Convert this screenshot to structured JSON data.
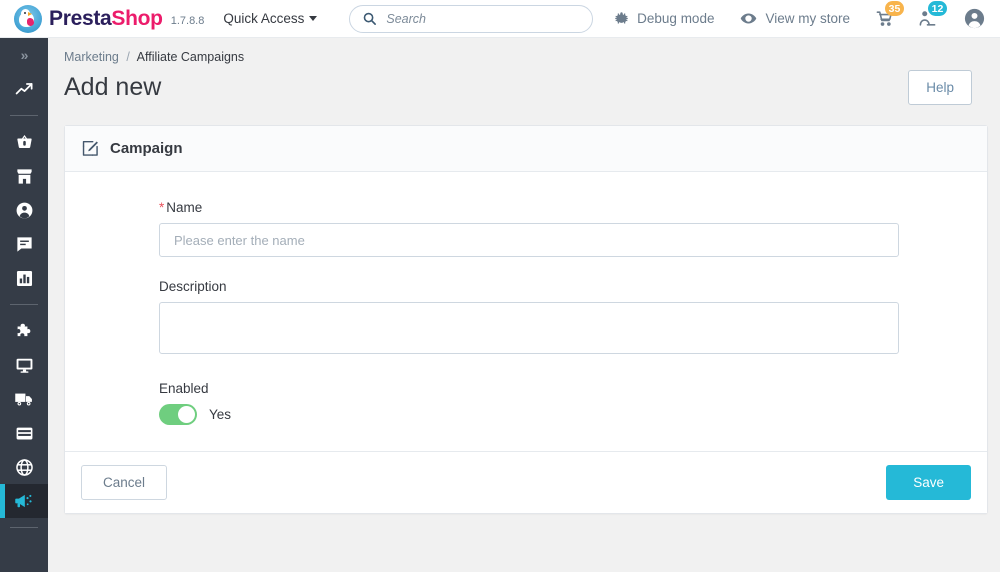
{
  "header": {
    "brand_primary": "Presta",
    "brand_secondary": "Shop",
    "version": "1.7.8.8",
    "quick_access_label": "Quick Access",
    "search_placeholder": "Search",
    "search_value": "",
    "debug_mode_label": "Debug mode",
    "view_store_label": "View my store",
    "orders_badge": "35",
    "customers_badge": "12",
    "badge_orange_color": "#f8b44c",
    "badge_blue_color": "#25b9d7"
  },
  "sidebar": {
    "expand_label": "»",
    "accent_color": "#25b9d7",
    "items": [
      {
        "name": "dashboard",
        "icon": "trending-up-icon"
      },
      {
        "name": "orders",
        "icon": "basket-icon"
      },
      {
        "name": "catalog",
        "icon": "store-icon"
      },
      {
        "name": "customers",
        "icon": "person-icon"
      },
      {
        "name": "customer-service",
        "icon": "chat-bubble-icon"
      },
      {
        "name": "stats",
        "icon": "bar-chart-icon"
      },
      {
        "name": "modules",
        "icon": "puzzle-icon"
      },
      {
        "name": "design",
        "icon": "monitor-icon"
      },
      {
        "name": "shipping",
        "icon": "truck-icon"
      },
      {
        "name": "payment",
        "icon": "credit-card-icon"
      },
      {
        "name": "international",
        "icon": "globe-icon"
      },
      {
        "name": "marketing",
        "icon": "megaphone-icon",
        "active": true
      }
    ]
  },
  "page": {
    "breadcrumb_parent": "Marketing",
    "breadcrumb_separator": "/",
    "breadcrumb_current": "Affiliate Campaigns",
    "title": "Add new",
    "help_label": "Help"
  },
  "card": {
    "header_title": "Campaign",
    "header_icon": "edit-pencil-icon",
    "fields": {
      "name": {
        "label": "Name",
        "required_marker": "*",
        "placeholder": "Please enter the name",
        "value": ""
      },
      "description": {
        "label": "Description",
        "placeholder": "",
        "value": ""
      },
      "enabled": {
        "label": "Enabled",
        "state_label": "Yes",
        "checked": true,
        "on_color": "#6fce7f"
      }
    },
    "footer": {
      "cancel_label": "Cancel",
      "save_label": "Save",
      "save_color": "#25b9d7"
    }
  }
}
